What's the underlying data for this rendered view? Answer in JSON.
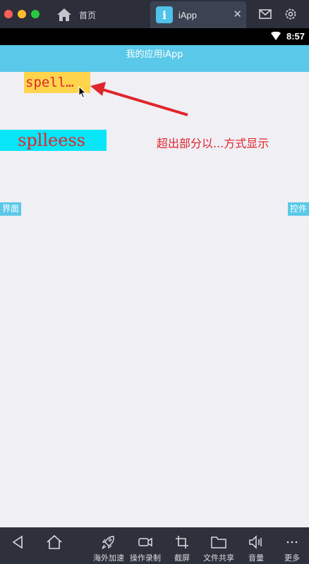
{
  "window": {
    "tabs": [
      {
        "label": "首页"
      },
      {
        "label": "iApp",
        "badge": "i",
        "close": "✕"
      }
    ]
  },
  "status_bar": {
    "time": "8:57"
  },
  "app": {
    "title": "我的应用iApp"
  },
  "content": {
    "ellipsized_text": "spell…",
    "full_text": "splleess",
    "annotation": "超出部分以...方式显示",
    "left_button": "界面",
    "right_button": "控件"
  },
  "toolbar": {
    "items": [
      {
        "label": "",
        "icon": "back-icon"
      },
      {
        "label": "",
        "icon": "home-icon"
      },
      {
        "label": "海外加速",
        "icon": "rocket-icon"
      },
      {
        "label": "操作录制",
        "icon": "video-icon"
      },
      {
        "label": "截屏",
        "icon": "crop-icon"
      },
      {
        "label": "文件共享",
        "icon": "folder-icon"
      },
      {
        "label": "音量",
        "icon": "volume-icon"
      },
      {
        "label": "更多",
        "icon": "more-icon"
      }
    ]
  },
  "colors": {
    "accent": "#5ac8e8",
    "highlight_yellow": "#fed44d",
    "highlight_cyan": "#08e6f8",
    "annotation_red": "#e0252c"
  }
}
